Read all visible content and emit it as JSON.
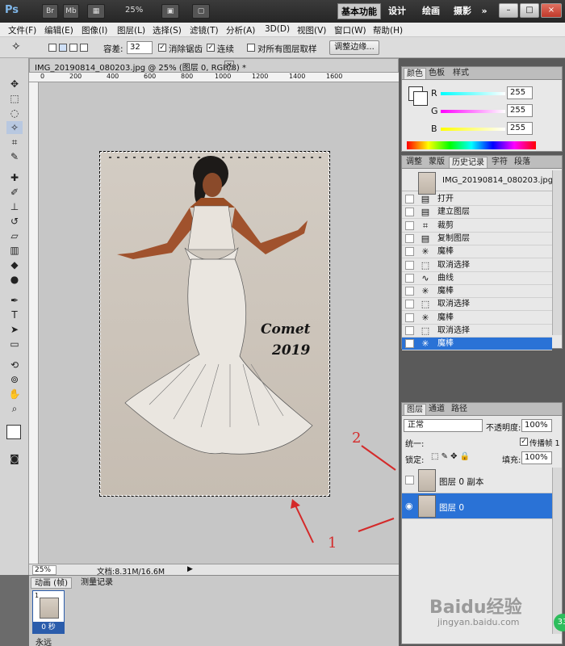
{
  "appbar": {
    "logo": "Ps",
    "btn_br": "Br",
    "btn_mb": "Mb",
    "zoom": "25%",
    "workspaces": [
      "基本功能",
      "设计",
      "绘画",
      "摄影",
      "»"
    ],
    "win_min": "–",
    "win_max": "□",
    "win_close": "×"
  },
  "menubar": [
    "文件(F)",
    "编辑(E)",
    "图像(I)",
    "图层(L)",
    "选择(S)",
    "滤镜(T)",
    "分析(A)",
    "3D(D)",
    "视图(V)",
    "窗口(W)",
    "帮助(H)"
  ],
  "options": {
    "tolerance_label": "容差:",
    "tolerance_value": "32",
    "antialias_label": "消除锯齿",
    "contiguous_label": "连续",
    "all_layers_label": "对所有图层取样",
    "refine_button": "调整边缘..."
  },
  "document": {
    "tab_title": "IMG_20190814_080203.jpg @ 25% (图层 0, RGB/8) *",
    "ruler_ticks": [
      "0",
      "200",
      "400",
      "600",
      "800",
      "1000",
      "1200",
      "1400",
      "1600"
    ],
    "zoom": "25%",
    "status": "文档:8.31M/16.6M"
  },
  "animation": {
    "tab_anim": "动画 (帧)",
    "tab_log": "测量记录",
    "frame_num": "1",
    "frame_time": "0 秒",
    "loop": "永远"
  },
  "color_panel": {
    "tabs": [
      "颜色",
      "色板",
      "样式"
    ],
    "r_label": "R",
    "r_value": "255",
    "g_label": "G",
    "g_value": "255",
    "b_label": "B",
    "b_value": "255"
  },
  "history_panel": {
    "tabs": [
      "调整",
      "蒙版",
      "历史记录",
      "字符",
      "段落"
    ],
    "snapshot": "IMG_20190814_080203.jpg",
    "items": [
      {
        "icon": "▤",
        "label": "打开"
      },
      {
        "icon": "▤",
        "label": "建立图层"
      },
      {
        "icon": "⌗",
        "label": "裁剪"
      },
      {
        "icon": "▤",
        "label": "复制图层"
      },
      {
        "icon": "✳",
        "label": "魔棒"
      },
      {
        "icon": "⬚",
        "label": "取消选择"
      },
      {
        "icon": "∿",
        "label": "曲线"
      },
      {
        "icon": "✳",
        "label": "魔棒"
      },
      {
        "icon": "⬚",
        "label": "取消选择"
      },
      {
        "icon": "✳",
        "label": "魔棒"
      },
      {
        "icon": "⬚",
        "label": "取消选择"
      },
      {
        "icon": "✳",
        "label": "魔棒"
      }
    ]
  },
  "layers_panel": {
    "tabs": [
      "图层",
      "通道",
      "路径"
    ],
    "blend_mode": "正常",
    "opacity_label": "不透明度:",
    "opacity_value": "100%",
    "unify_label": "统一:",
    "propagate_label": "传播帧 1",
    "lock_label": "锁定:",
    "fill_label": "填充:",
    "fill_value": "100%",
    "layers": [
      {
        "name": "图层 0 副本",
        "visible": false,
        "selected": false
      },
      {
        "name": "图层 0",
        "visible": true,
        "selected": true
      }
    ]
  },
  "annotations": {
    "label_1": "1",
    "label_2": "2"
  },
  "watermark": {
    "site": "Baidu经验",
    "url": "jingyan.baidu.com",
    "badge": "33"
  },
  "colors": {
    "accent": "#2a72d6",
    "annotation": "#d42a2a"
  }
}
